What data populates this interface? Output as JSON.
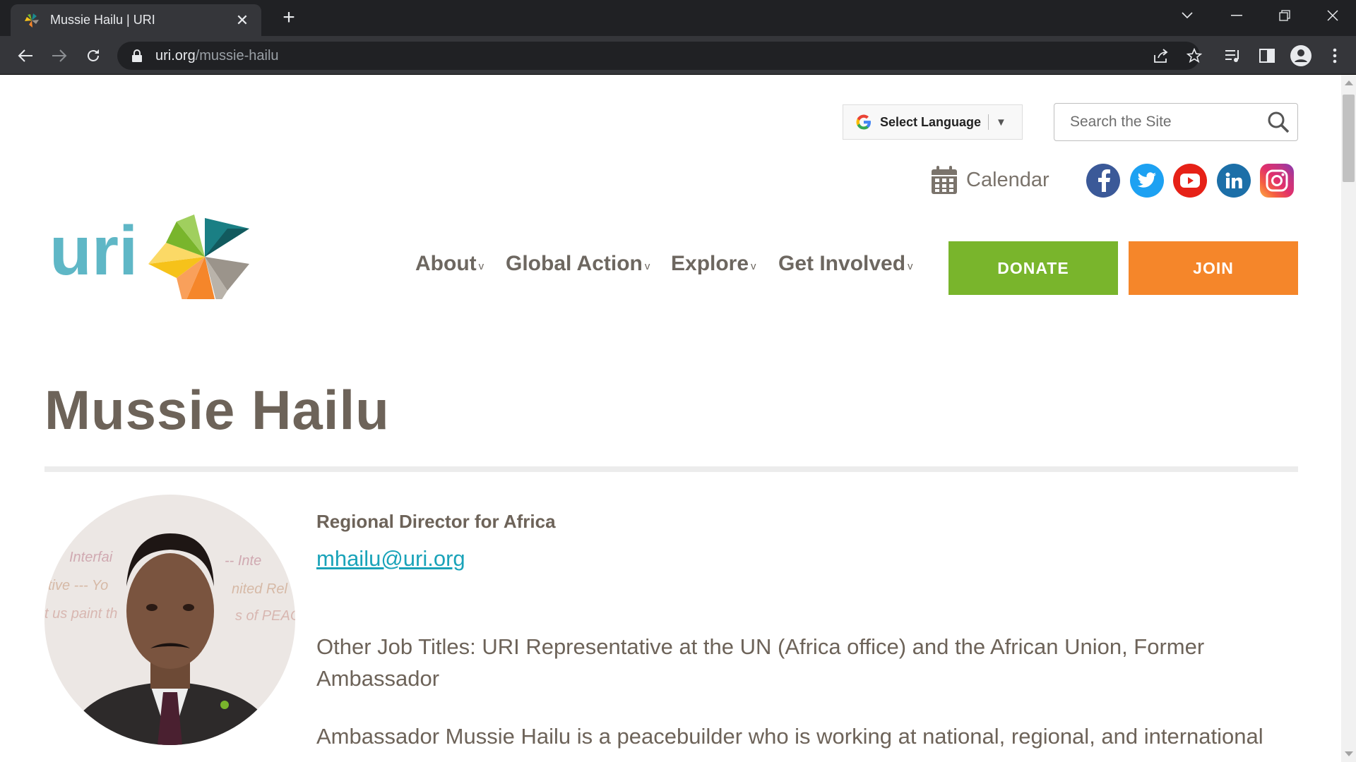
{
  "browser": {
    "tab_title": "Mussie Hailu | URI",
    "new_tab_symbol": "+",
    "url_host": "uri.org",
    "url_path": "/mussie-hailu"
  },
  "header": {
    "language_label": "Select Language",
    "search_placeholder": "Search the Site",
    "calendar_label": "Calendar",
    "social": [
      {
        "name": "facebook",
        "color": "#3b5998"
      },
      {
        "name": "twitter",
        "color": "#1da1f2"
      },
      {
        "name": "youtube",
        "color": "#e62117"
      },
      {
        "name": "linkedin",
        "color": "#1c6fa8"
      },
      {
        "name": "instagram",
        "color": "#e1306c"
      }
    ],
    "logo_text": "uri"
  },
  "nav": {
    "items": [
      {
        "label": "About"
      },
      {
        "label": "Global Action"
      },
      {
        "label": "Explore"
      },
      {
        "label": "Get Involved"
      }
    ],
    "donate_label": "DONATE",
    "join_label": "JOIN"
  },
  "profile": {
    "name": "Mussie Hailu",
    "role": "Regional Director for Africa",
    "email": "mhailu@uri.org",
    "other_titles": "Other Job Titles: URI Representative at the UN (Africa office)  and the African Union, Former Ambassador",
    "bio": "Ambassador Mussie Hailu is a peacebuilder who is working at national, regional, and international"
  },
  "colors": {
    "donate": "#79b52c",
    "join": "#f5862a",
    "title_text": "#6d6359",
    "link": "#1aa3b9"
  }
}
